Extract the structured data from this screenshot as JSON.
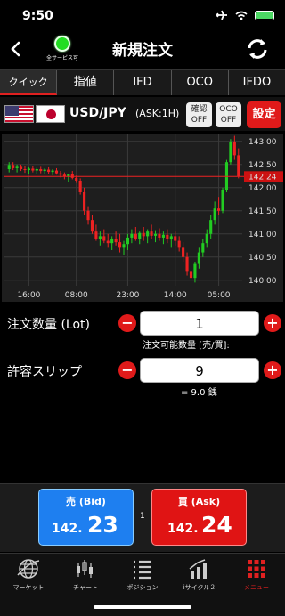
{
  "status": {
    "time": "9:50"
  },
  "header": {
    "title": "新規注文",
    "service_label": "全サービス可"
  },
  "tabs": [
    {
      "label": "クイック",
      "active": true
    },
    {
      "label": "指値"
    },
    {
      "label": "IFD"
    },
    {
      "label": "OCO"
    },
    {
      "label": "IFDO"
    }
  ],
  "pair": {
    "name": "USD/JPY",
    "ask_info": "(ASK:1H)",
    "confirm_line1": "確認",
    "confirm_line2": "OFF",
    "oco_line1": "OCO",
    "oco_line2": "OFF",
    "settings_label": "設定"
  },
  "chart_data": {
    "type": "candlestick",
    "y_ticks": [
      "143.00",
      "142.50",
      "142.00",
      "141.50",
      "141.00",
      "140.50",
      "140.00"
    ],
    "y_range": [
      139.88,
      143.15
    ],
    "x_ticks": [
      "16:00",
      "08:00",
      "23:00",
      "14:00",
      "05:00"
    ],
    "current_price_label": "142.24",
    "current_price": 142.24,
    "colors": {
      "up": "#22cc22",
      "down": "#ee2222",
      "grid": "#3a3a3a"
    },
    "candles": [
      [
        142.4,
        142.55,
        142.33,
        142.49
      ],
      [
        142.49,
        142.55,
        142.38,
        142.42
      ],
      [
        142.42,
        142.5,
        142.33,
        142.45
      ],
      [
        142.45,
        142.5,
        142.36,
        142.4
      ],
      [
        142.4,
        142.46,
        142.32,
        142.38
      ],
      [
        142.38,
        142.44,
        142.3,
        142.41
      ],
      [
        142.41,
        142.47,
        142.33,
        142.37
      ],
      [
        142.37,
        142.43,
        142.29,
        142.4
      ],
      [
        142.4,
        142.45,
        142.31,
        142.36
      ],
      [
        142.36,
        142.42,
        142.29,
        142.39
      ],
      [
        142.39,
        142.44,
        142.3,
        142.34
      ],
      [
        142.34,
        142.4,
        142.27,
        142.37
      ],
      [
        142.37,
        142.42,
        142.28,
        142.31
      ],
      [
        142.31,
        142.36,
        142.22,
        142.28
      ],
      [
        142.28,
        142.33,
        142.18,
        142.24
      ],
      [
        142.24,
        142.3,
        142.13,
        142.3
      ],
      [
        142.3,
        142.36,
        142.18,
        142.21
      ],
      [
        142.21,
        142.26,
        142.1,
        142.15
      ],
      [
        142.15,
        142.2,
        141.85,
        141.9
      ],
      [
        141.9,
        142.0,
        141.4,
        141.5
      ],
      [
        141.5,
        141.6,
        141.2,
        141.3
      ],
      [
        141.3,
        141.4,
        141.0,
        141.05
      ],
      [
        141.05,
        141.2,
        140.85,
        140.9
      ],
      [
        140.9,
        141.05,
        140.75,
        140.95
      ],
      [
        140.95,
        141.1,
        140.8,
        140.85
      ],
      [
        140.85,
        141.0,
        140.7,
        140.8
      ],
      [
        140.8,
        140.95,
        140.65,
        140.9
      ],
      [
        140.9,
        141.05,
        140.75,
        140.82
      ],
      [
        140.82,
        141.0,
        140.6,
        140.7
      ],
      [
        140.7,
        140.85,
        140.55,
        140.78
      ],
      [
        140.78,
        141.0,
        140.65,
        140.92
      ],
      [
        140.92,
        141.1,
        140.8,
        141.0
      ],
      [
        141.0,
        141.15,
        140.85,
        140.9
      ],
      [
        140.9,
        141.05,
        140.78,
        141.02
      ],
      [
        141.02,
        141.15,
        140.85,
        140.95
      ],
      [
        140.95,
        141.1,
        140.8,
        141.05
      ],
      [
        141.05,
        141.2,
        140.9,
        140.96
      ],
      [
        140.96,
        141.08,
        140.82,
        141.0
      ],
      [
        141.0,
        141.12,
        140.85,
        140.92
      ],
      [
        140.92,
        141.05,
        140.78,
        140.98
      ],
      [
        140.98,
        141.1,
        140.8,
        140.88
      ],
      [
        140.88,
        141.0,
        140.7,
        140.95
      ],
      [
        140.95,
        141.05,
        140.75,
        140.85
      ],
      [
        140.85,
        140.95,
        140.62,
        140.7
      ],
      [
        140.7,
        140.82,
        140.4,
        140.5
      ],
      [
        140.5,
        140.6,
        140.1,
        140.2
      ],
      [
        140.2,
        140.3,
        139.9,
        140.05
      ],
      [
        140.05,
        140.4,
        139.95,
        140.35
      ],
      [
        140.35,
        140.7,
        140.25,
        140.6
      ],
      [
        140.6,
        140.9,
        140.5,
        140.8
      ],
      [
        140.8,
        141.1,
        140.7,
        141.0
      ],
      [
        141.0,
        141.4,
        140.9,
        141.3
      ],
      [
        141.3,
        141.7,
        141.2,
        141.55
      ],
      [
        141.55,
        141.8,
        141.4,
        141.5
      ],
      [
        141.5,
        142.0,
        141.45,
        141.95
      ],
      [
        141.95,
        142.6,
        141.9,
        142.55
      ],
      [
        142.55,
        143.05,
        142.5,
        142.98
      ],
      [
        142.98,
        143.12,
        142.6,
        142.7
      ],
      [
        142.7,
        142.85,
        142.2,
        142.24
      ]
    ]
  },
  "order": {
    "qty_label": "注文数量 (Lot)",
    "qty_value": "1",
    "qty_available": "注文可能数量 [売/買]:",
    "slip_label": "許容スリップ",
    "slip_value": "9",
    "slip_note": "= 9.0 銭",
    "minus": "−",
    "plus": "+"
  },
  "prices": {
    "bid_label": "売 (Bid)",
    "bid_small": "142.",
    "bid_big": "23",
    "ask_label": "買 (Ask)",
    "ask_small": "142.",
    "ask_big": "24",
    "spread": "1"
  },
  "tabbar": [
    {
      "label": "マーケット",
      "icon": "globe-icon"
    },
    {
      "label": "チャート",
      "icon": "candlestick-icon"
    },
    {
      "label": "ポジション",
      "icon": "list-icon"
    },
    {
      "label": "iサイクル２",
      "icon": "bar-chart-icon"
    },
    {
      "label": "メニュー",
      "icon": "grid-menu-icon",
      "active": true
    }
  ]
}
